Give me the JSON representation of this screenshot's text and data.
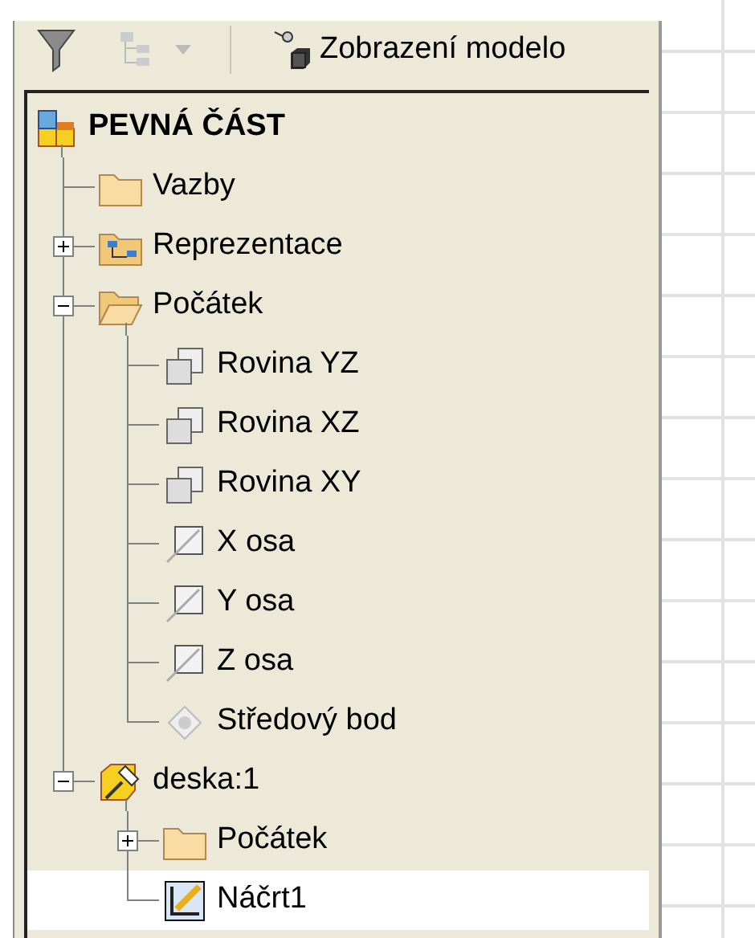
{
  "toolbar": {
    "view_label": "Zobrazení modelo"
  },
  "tree": {
    "label": "PEVNÁ ČÁST",
    "kind": "part",
    "children": [
      {
        "label": "Vazby",
        "kind": "folder",
        "selected": false
      },
      {
        "label": "Reprezentace",
        "kind": "representation",
        "expanded": false,
        "selected": false
      },
      {
        "label": "Počátek",
        "kind": "open-folder",
        "expanded": true,
        "selected": false,
        "children": [
          {
            "label": "Rovina YZ",
            "kind": "plane",
            "selected": false
          },
          {
            "label": "Rovina XZ",
            "kind": "plane",
            "selected": false
          },
          {
            "label": "Rovina XY",
            "kind": "plane",
            "selected": false
          },
          {
            "label": "X osa",
            "kind": "axis",
            "selected": false
          },
          {
            "label": "Y osa",
            "kind": "axis",
            "selected": false
          },
          {
            "label": "Z osa",
            "kind": "axis",
            "selected": false
          },
          {
            "label": "Středový bod",
            "kind": "point",
            "selected": false
          }
        ]
      },
      {
        "label": "deska:1",
        "kind": "component",
        "expanded": true,
        "selected": false,
        "children": [
          {
            "label": "Počátek",
            "kind": "folder",
            "expanded": false,
            "selected": false
          },
          {
            "label": "Náčrt1",
            "kind": "sketch",
            "selected": true
          }
        ]
      }
    ]
  }
}
